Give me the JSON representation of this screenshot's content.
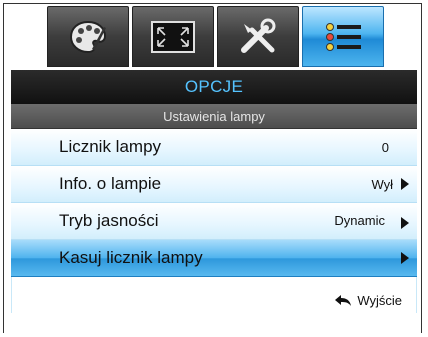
{
  "tabs": [
    {
      "icon": "palette-icon",
      "active": false
    },
    {
      "icon": "screen-fit-icon",
      "active": false
    },
    {
      "icon": "tools-icon",
      "active": false
    },
    {
      "icon": "list-menu-icon",
      "active": true
    }
  ],
  "menu": {
    "title": "OPCJE",
    "subtitle": "Ustawienia lampy",
    "items": [
      {
        "label": "Licznik lampy",
        "value": "0"
      },
      {
        "label": "Info. o lampie",
        "value": "Wył"
      },
      {
        "label": "Tryb jasności",
        "value": "Dynamic"
      },
      {
        "label": "Kasuj licznik lampy",
        "value": ""
      }
    ],
    "exit_label": "Wyjście"
  },
  "colors": {
    "title_text": "#55c3ff",
    "selected_row": "#4fb3ee",
    "active_tab": "#4eb5f0"
  }
}
